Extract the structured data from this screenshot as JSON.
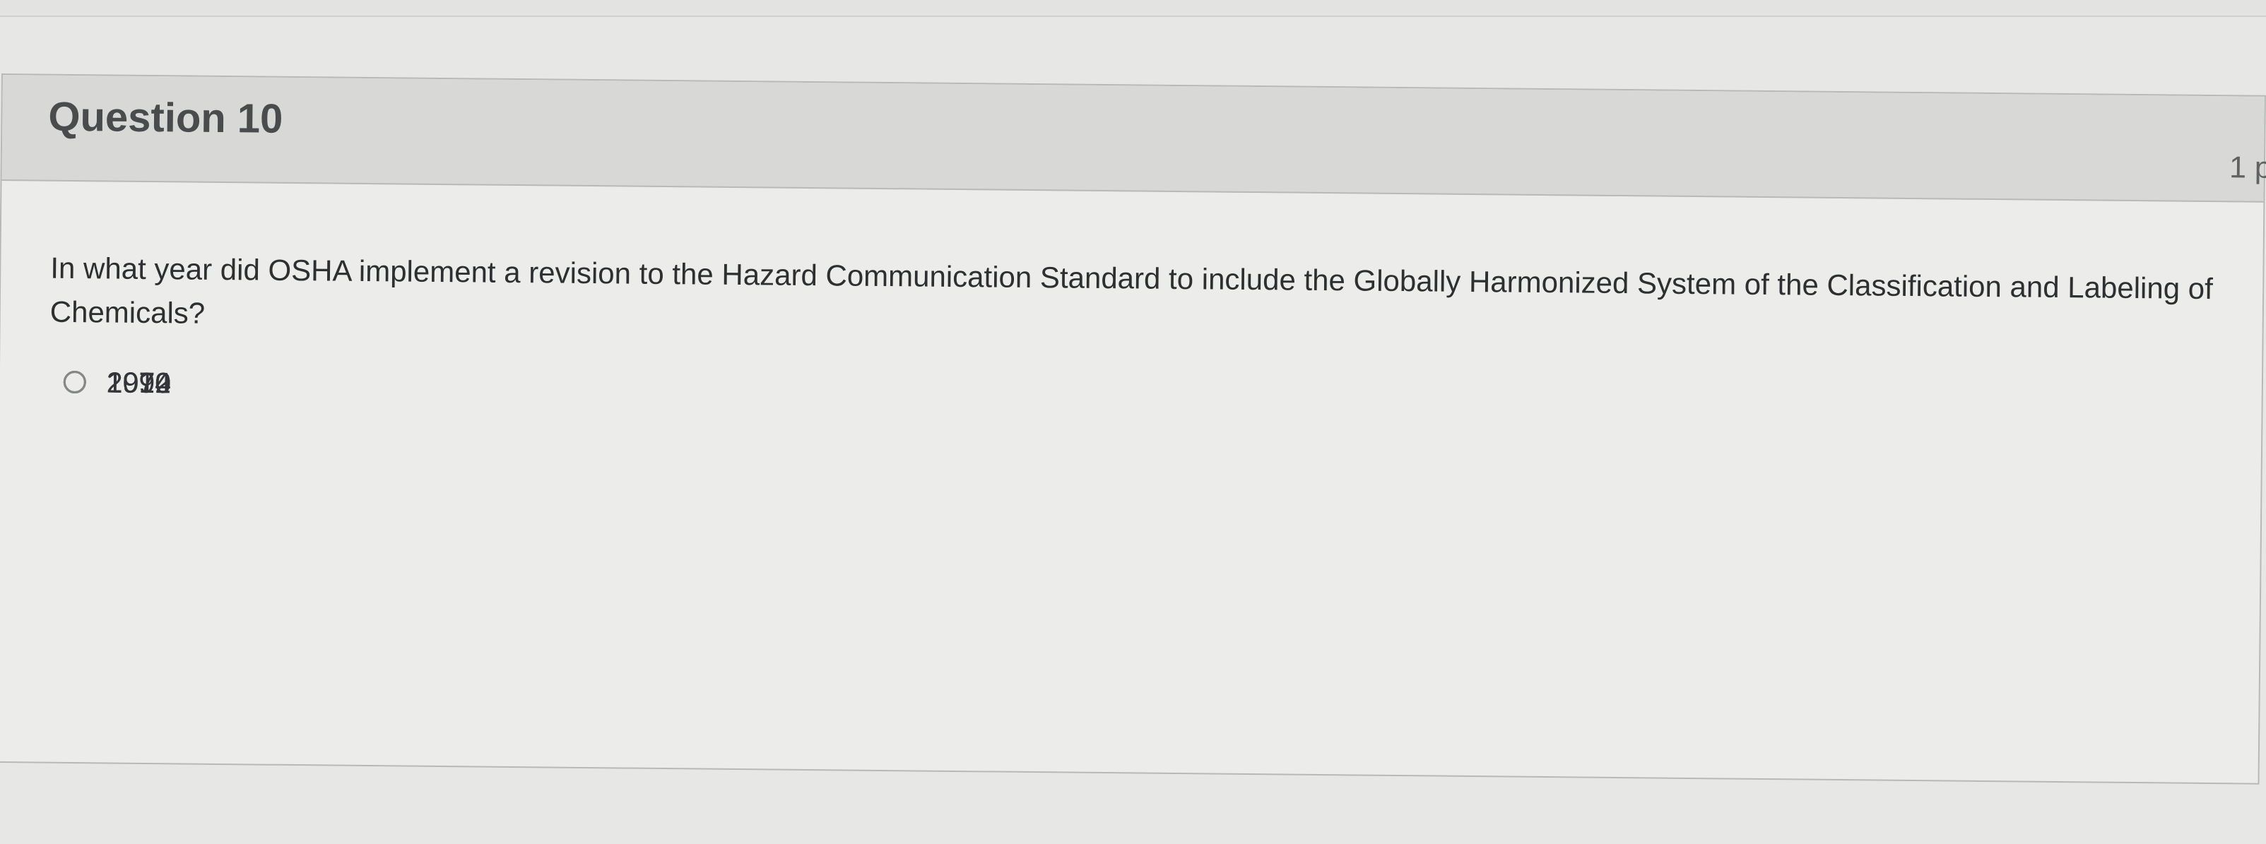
{
  "question": {
    "title": "Question 10",
    "points": "1 p",
    "prompt": "In what year did OSHA implement a revision to the Hazard Communication Standard to include the Globally Harmonized System of the Classification and Labeling of Chemicals?",
    "answers": [
      {
        "label": "1970",
        "icon": "radio-unselected-icon"
      },
      {
        "label": "1974",
        "icon": "radio-unselected-icon"
      },
      {
        "label": "1990",
        "icon": "radio-unselected-icon"
      },
      {
        "label": "2012",
        "icon": "radio-unselected-icon"
      }
    ]
  }
}
